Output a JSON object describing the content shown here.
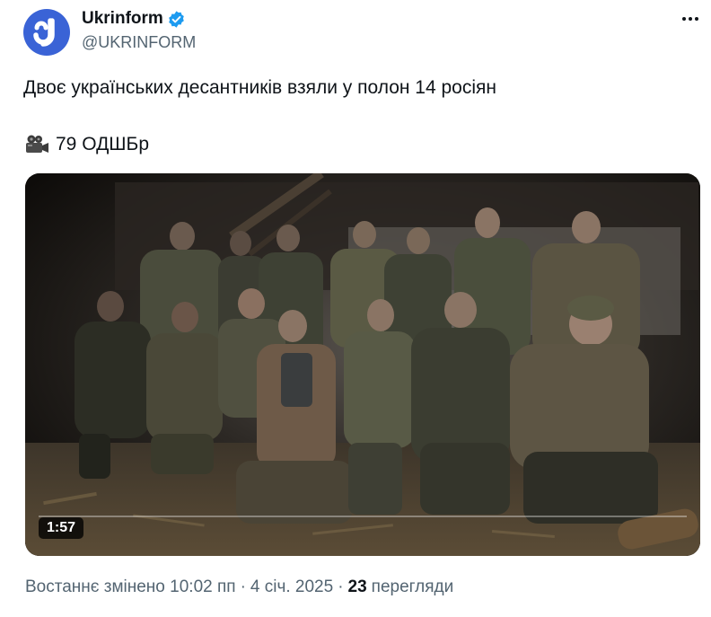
{
  "header": {
    "display_name": "Ukrinform",
    "handle": "@UKRINFORM",
    "avatar_icon": "ukrinform-logo",
    "verified_icon": "verified-badge-icon",
    "more_icon": "more-options-icon",
    "brand_color": "#3a63d6"
  },
  "tweet": {
    "line1": "Двоє українських десантників взяли у полон 14 росіян",
    "line2_icon": "movie-camera-icon",
    "line2": "79 ОДШБр"
  },
  "media": {
    "type": "video",
    "duration": "1:57",
    "progress": 0.0
  },
  "footer": {
    "edited_label": "Востаннє змінено",
    "time": "10:02 пп",
    "separator": "·",
    "date": "4 січ. 2025",
    "views_count": "23",
    "views_label": "перегляди"
  }
}
